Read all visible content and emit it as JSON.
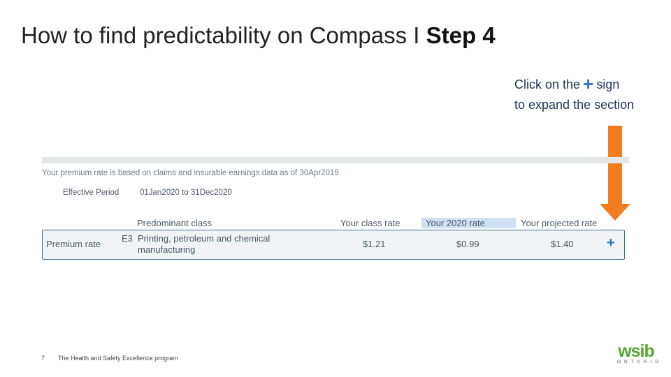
{
  "title": {
    "main": "How to find predictability on Compass I ",
    "bold": "Step 4"
  },
  "callout": {
    "prefix": "Click on the",
    "suffix": "sign",
    "line2": "to expand the section"
  },
  "panel": {
    "basis_text": "Your premium rate is based on claims and insurable earnings data as of 30Apr2019",
    "effective_label": "Effective Period",
    "effective_value": "01Jan2020 to 31Dec2020",
    "columns": {
      "predominant": "Predominant class",
      "class_rate": "Your class rate",
      "year_rate": "Your 2020 rate",
      "projected": "Your projected rate"
    },
    "row": {
      "label": "Premium rate",
      "class_code": "E3",
      "class_line1": "Printing, petroleum and chemical",
      "class_line2": "manufacturing",
      "class_rate": "$1.21",
      "year_rate": "$0.99",
      "projected_rate": "$1.40",
      "expand": "+"
    }
  },
  "footer": {
    "page_number": "7",
    "program": "The Health and Safety Excellence program"
  },
  "logo": {
    "word": "wsib",
    "sub": "ONTARIO"
  },
  "colors": {
    "accent": "#2a73c9",
    "arrow": "#f47c20",
    "highlight": "#cfe1f5",
    "logo_green": "#55a630"
  }
}
